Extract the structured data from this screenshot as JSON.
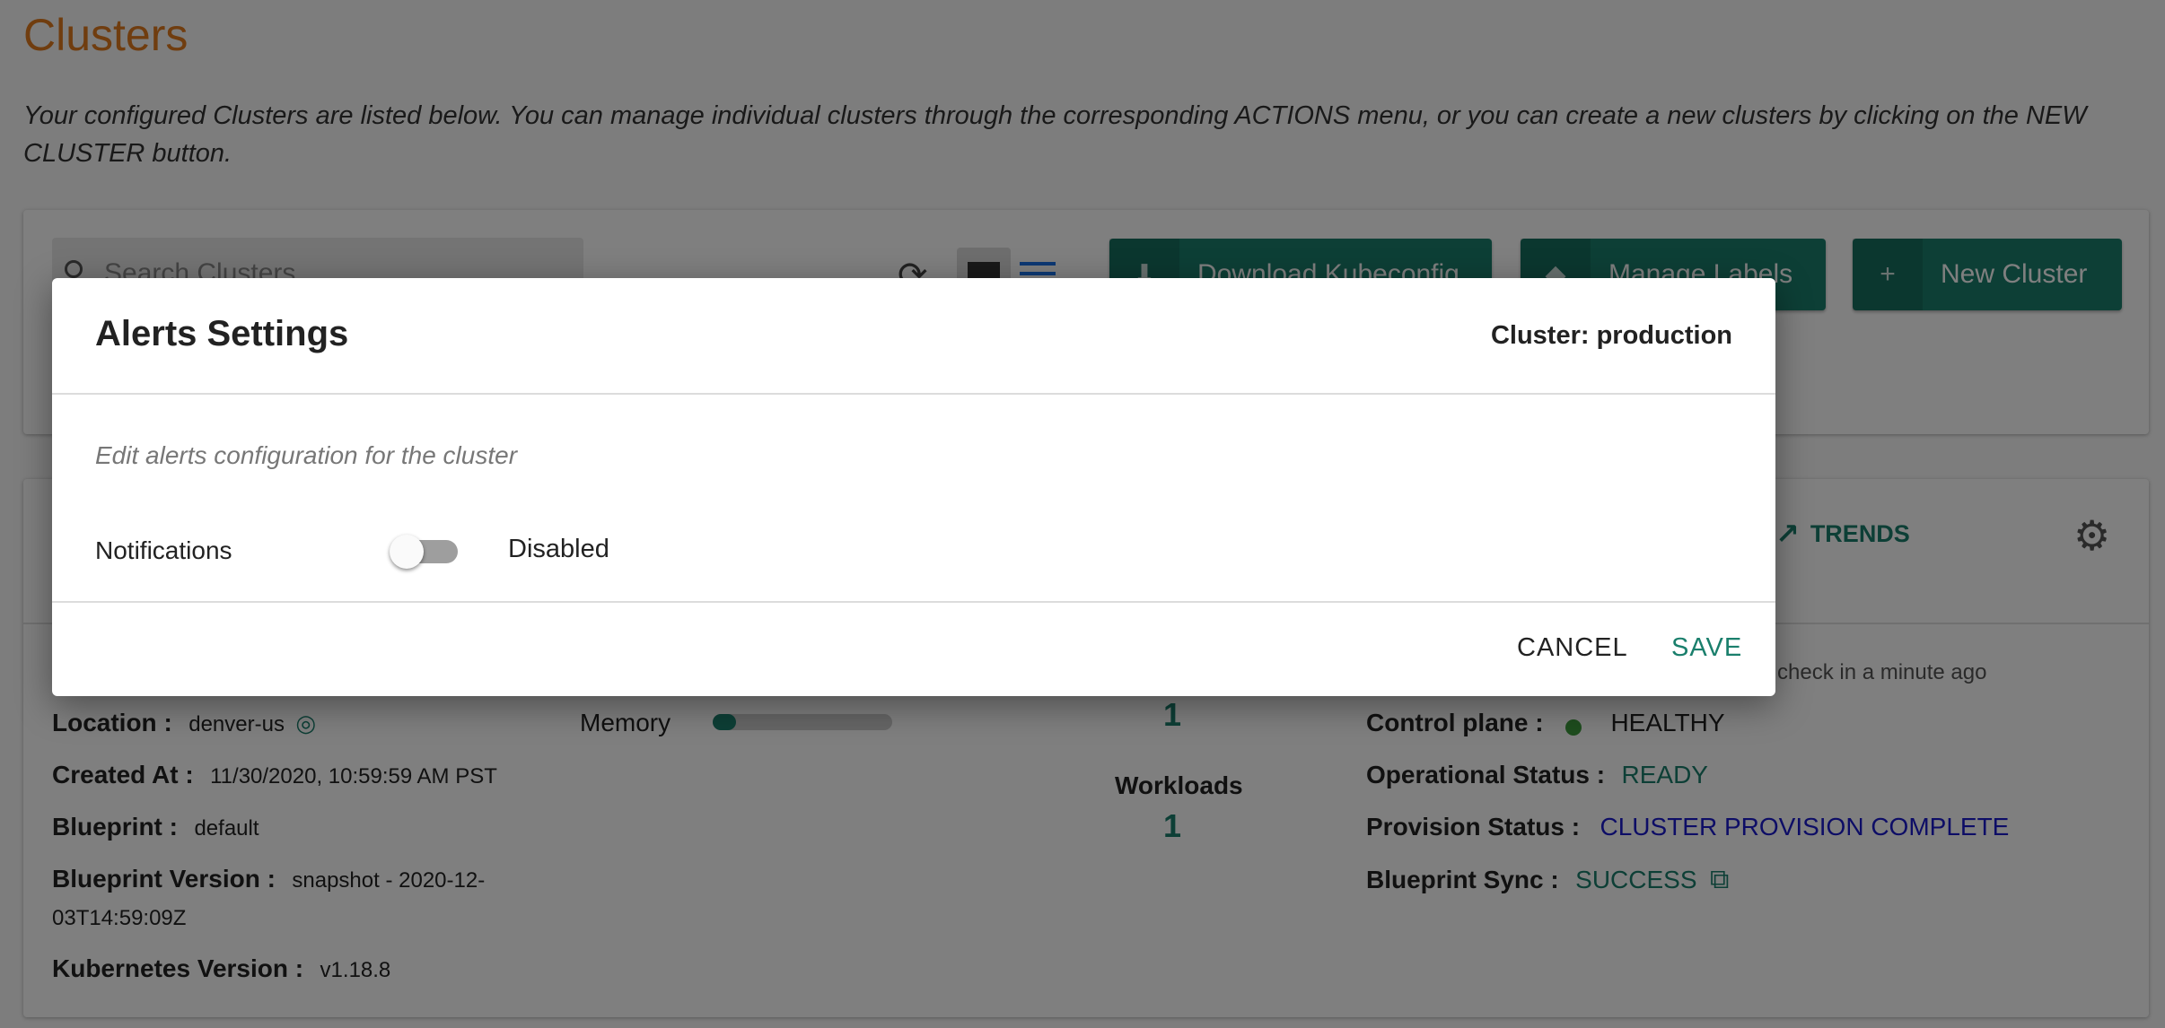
{
  "page": {
    "title": "Clusters",
    "description": "Your configured Clusters are listed below. You can manage individual clusters through the corresponding ACTIONS menu, or you can create a new clusters by clicking on the NEW CLUSTER button."
  },
  "toolbar": {
    "search_placeholder": "Search Clusters",
    "download_label": "Download Kubeconfig",
    "manage_labels_label": "Manage Labels",
    "new_cluster_label": "New Cluster"
  },
  "cluster_card": {
    "trends_label": "TRENDS",
    "health_check_text": "check in a minute ago",
    "location_label": "Location :",
    "location_value": "denver-us",
    "created_label": "Created At :",
    "created_value": "11/30/2020, 10:59:59 AM PST",
    "blueprint_label": "Blueprint :",
    "blueprint_value": "default",
    "blueprint_version_label": "Blueprint Version :",
    "blueprint_version_value_1": "snapshot - 2020-12-",
    "blueprint_version_value_2": "03T14:59:09Z",
    "k8s_label": "Kubernetes Version :",
    "k8s_value": "v1.18.8",
    "memory_label": "Memory",
    "memory_fraction": 0.13,
    "count_top": "1",
    "workloads_label": "Workloads",
    "workloads_value": "1",
    "control_plane_label": "Control plane :",
    "control_plane_value": "HEALTHY",
    "operational_label": "Operational Status :",
    "operational_value": "READY",
    "provision_label": "Provision Status :",
    "provision_value": "CLUSTER PROVISION COMPLETE",
    "blueprint_sync_label": "Blueprint Sync :",
    "blueprint_sync_value": "SUCCESS"
  },
  "modal": {
    "title": "Alerts Settings",
    "cluster_label": "Cluster: production",
    "description": "Edit alerts configuration for the cluster",
    "notifications_label": "Notifications",
    "notifications_state": "Disabled",
    "cancel_label": "CANCEL",
    "save_label": "SAVE"
  },
  "colors": {
    "accent_teal": "#1a7f6c",
    "title_orange": "#e07b1f",
    "provision_blue": "#1a1acc"
  },
  "icons": [
    "search-icon",
    "refresh-icon",
    "grid-view-icon",
    "list-view-icon",
    "download-icon",
    "label-icon",
    "plus-icon",
    "trends-icon",
    "gear-icon",
    "location-target-icon",
    "external-link-icon"
  ]
}
